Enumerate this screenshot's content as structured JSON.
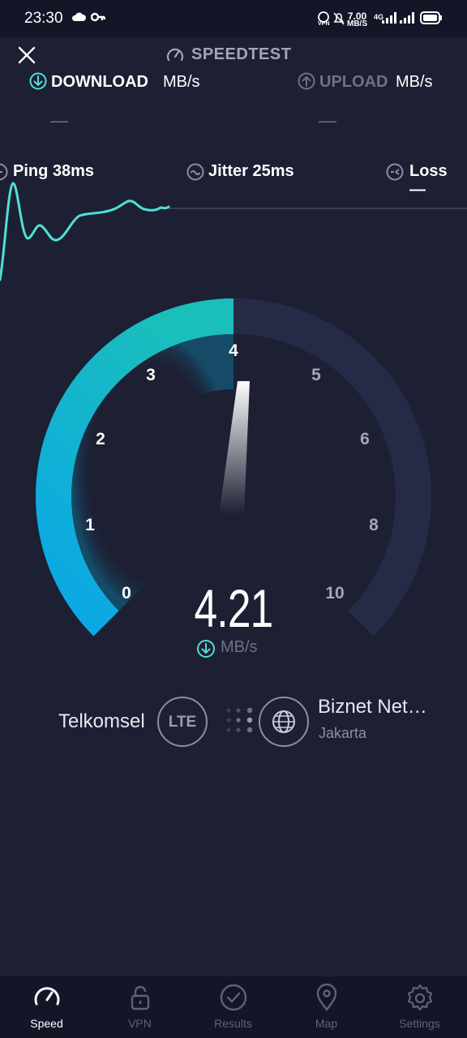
{
  "status_bar": {
    "time": "23:30",
    "net_rate": "7.00",
    "net_rate_unit": "MB/S",
    "network_tag": "4G"
  },
  "header": {
    "title": "SPEEDTEST"
  },
  "download": {
    "label": "DOWNLOAD",
    "unit": "MB/s",
    "value": "—"
  },
  "upload": {
    "label": "UPLOAD",
    "unit": "MB/s",
    "value": "—"
  },
  "stats": {
    "ping": "Ping 38ms",
    "jitter": "Jitter 25ms",
    "loss": "Loss —"
  },
  "gauge": {
    "ticks": [
      "0",
      "1",
      "2",
      "3",
      "4",
      "5",
      "6",
      "8",
      "10"
    ],
    "value": "4.21",
    "unit": "MB/s",
    "fill_fraction": 0.5,
    "accent_colors": [
      "#0aa6e8",
      "#1bbfba"
    ]
  },
  "connection": {
    "carrier": "Telkomsel",
    "carrier_tech": "LTE",
    "server_name": "Biznet Net…",
    "server_city": "Jakarta"
  },
  "bottom_nav": [
    {
      "label": "Speed",
      "icon": "speedometer-icon",
      "active": true
    },
    {
      "label": "VPN",
      "icon": "lock-icon",
      "active": false
    },
    {
      "label": "Results",
      "icon": "check-circle-icon",
      "active": false
    },
    {
      "label": "Map",
      "icon": "map-pin-icon",
      "active": false
    },
    {
      "label": "Settings",
      "icon": "gear-icon",
      "active": false
    }
  ]
}
